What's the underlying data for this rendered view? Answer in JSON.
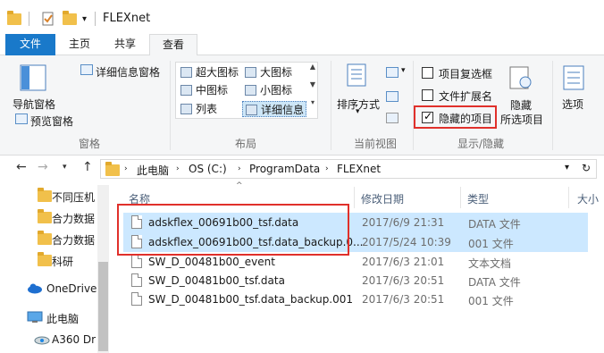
{
  "window": {
    "title": "FLEXnet"
  },
  "tabs": {
    "file": "文件",
    "home": "主页",
    "share": "共享",
    "view": "查看"
  },
  "ribbon": {
    "panes": {
      "nav_pane": "导航窗格",
      "preview_pane": "预览窗格",
      "details_pane": "详细信息窗格",
      "group": "窗格"
    },
    "layout": {
      "extra_large": "超大图标",
      "large": "大图标",
      "medium": "中图标",
      "small": "小图标",
      "list": "列表",
      "details": "详细信息",
      "group": "布局"
    },
    "current_view": {
      "sort_by": "排序方式",
      "group": "当前视图"
    },
    "show_hide": {
      "item_checkboxes": "项目复选框",
      "item_checkboxes_checked": false,
      "file_extensions": "文件扩展名",
      "file_extensions_checked": false,
      "hidden_items": "隐藏的项目",
      "hidden_items_checked": true,
      "hide_selected_line1": "隐藏",
      "hide_selected_line2": "所选项目",
      "group": "显示/隐藏"
    },
    "options": "选项"
  },
  "address": {
    "crumbs": [
      "此电脑",
      "OS (C:)",
      "ProgramData",
      "FLEXnet"
    ]
  },
  "nav": {
    "items": [
      {
        "label": "不同压机",
        "icon": "folder-icon"
      },
      {
        "label": "合力数据",
        "icon": "folder-icon"
      },
      {
        "label": "合力数据",
        "icon": "folder-icon"
      },
      {
        "label": "科研",
        "icon": "folder-icon"
      },
      {
        "label": "OneDrive",
        "icon": "cloud-icon"
      },
      {
        "label": "此电脑",
        "icon": "computer-icon"
      },
      {
        "label": "A360 Dr",
        "icon": "drive-icon"
      }
    ]
  },
  "columns": {
    "name": "名称",
    "modified": "修改日期",
    "type": "类型",
    "size": "大小"
  },
  "files": [
    {
      "name": "adskflex_00691b00_tsf.data",
      "date": "2017/6/9 21:31",
      "type": "DATA 文件",
      "selected": true
    },
    {
      "name": "adskflex_00691b00_tsf.data_backup.0...",
      "date": "2017/5/24 10:39",
      "type": "001 文件",
      "selected": true
    },
    {
      "name": "SW_D_00481b00_event",
      "date": "2017/6/3 21:01",
      "type": "文本文档",
      "selected": false
    },
    {
      "name": "SW_D_00481b00_tsf.data",
      "date": "2017/6/3 20:51",
      "type": "DATA 文件",
      "selected": false
    },
    {
      "name": "SW_D_00481b00_tsf.data_backup.001",
      "date": "2017/6/3 20:51",
      "type": "001 文件",
      "selected": false
    }
  ],
  "colors": {
    "accent": "#1979ca",
    "selection": "#cce8ff",
    "highlight_box": "#e0302b"
  }
}
